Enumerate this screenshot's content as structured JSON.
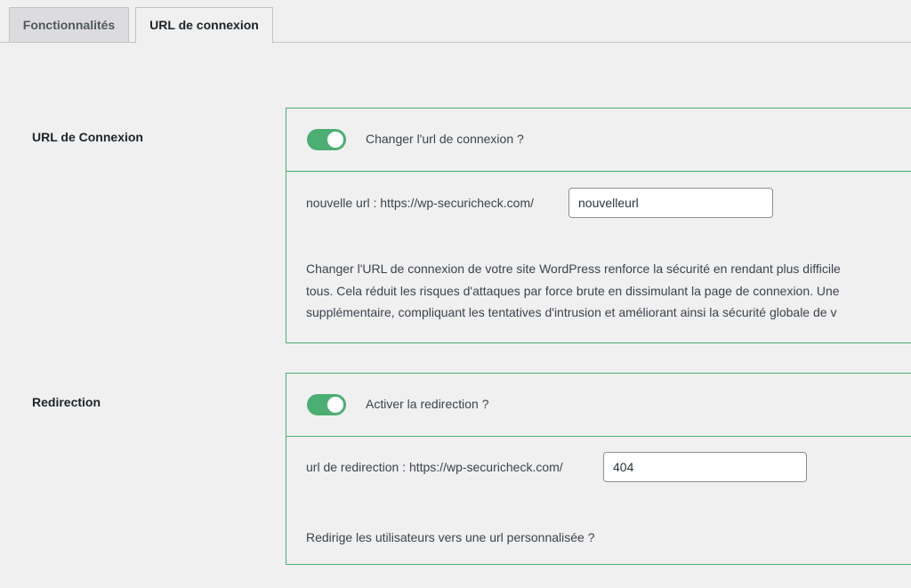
{
  "tabs": [
    {
      "label": "Fonctionnalités",
      "active": false
    },
    {
      "label": "URL de connexion",
      "active": true
    }
  ],
  "login_url": {
    "row_label": "URL de Connexion",
    "toggle_on": true,
    "toggle_label": "Changer l'url de connexion ?",
    "field_prefix": "nouvelle url : https://wp-securicheck.com/",
    "field_value": "nouvelleurl",
    "description_lines": [
      "Changer l'URL de connexion de votre site WordPress renforce la sécurité en rendant plus difficile",
      "tous. Cela réduit les risques d'attaques par force brute en dissimulant la page de connexion. Une",
      "supplémentaire, compliquant les tentatives d'intrusion et améliorant ainsi la sécurité globale de v"
    ]
  },
  "redirection": {
    "row_label": "Redirection",
    "toggle_on": true,
    "toggle_label": "Activer la redirection ?",
    "field_prefix": "url de redirection : https://wp-securicheck.com/",
    "field_value": "404",
    "description": "Redirige les utilisateurs vers une url personnalisée ?"
  },
  "colors": {
    "accent_green": "#4cae73",
    "background": "#f0f0f1",
    "inactive_tab": "#dcdcde"
  }
}
